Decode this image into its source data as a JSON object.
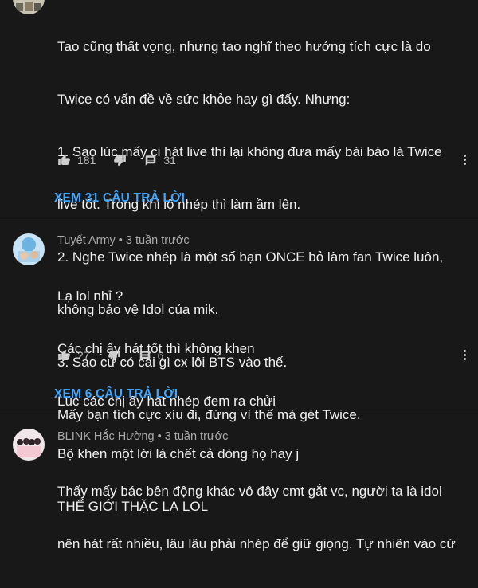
{
  "comments": [
    {
      "author": "",
      "lines": [
        "Tao cũng thất vọng, nhưng tao nghĩ theo hướng tích cực là do",
        "Twice có vấn đề về sức khỏe hay gì đấy. Nhưng:",
        "1. Sao lúc mấy ci hát live thì lại không đưa mấy bài báo là Twice",
        "live tốt. Trong khi lộ nhép thì làm ầm lên.",
        "2. Nghe Twice nhép là một số bạn ONCE bỏ làm fan Twice luôn,",
        "không bảo vệ Idol của mik.",
        "3. Sao cứ có cái gì cx lôi BTS vào thế.",
        "Mấy bạn tích cực xíu đi, đừng vì thế mà gét Twice."
      ],
      "likes": "181",
      "replies_count": "31",
      "view_replies": "XEM 31 CÂU TRẢ LỜI"
    },
    {
      "author": "Tuyết Army • 3 tuần trước",
      "lines": [
        "Lạ lol nhỉ ?",
        "Các chị ấy hát tốt thì không khen",
        "Lúc các chị ấy hát nhép đem ra chửi",
        "Bộ khen một lời là chết cả dòng họ hay j",
        "THẾ GIỚI THẶC LẠ LOL"
      ],
      "likes": "27",
      "replies_count": "6",
      "view_replies": "XEM 6 CÂU TRẢ LỜI"
    },
    {
      "author": "BLINK Hắc Hường • 3 tuần trước",
      "lines": [
        "Thấy mấy bác bên động khác vô đây cmt gắt vc, người ta là idol",
        "nên hát rất nhiều, lâu lâu phải nhép để giữ giọng. Tự nhiên vào cứ"
      ]
    }
  ],
  "icons": {
    "like": "thumbs-up-icon",
    "dislike": "thumbs-down-icon",
    "reply": "comment-icon",
    "menu": "more-vert-icon"
  },
  "colors": {
    "background": "#181818",
    "link": "#3ea6ff",
    "meta": "#aaaaaa"
  }
}
